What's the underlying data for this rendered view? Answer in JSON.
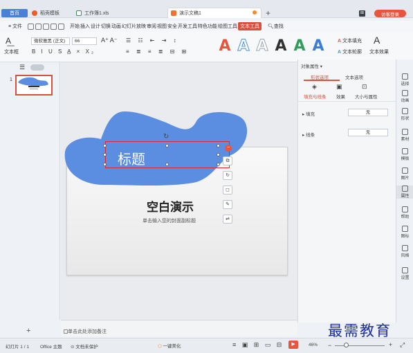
{
  "tabs": {
    "home": "首页",
    "docer": "稻壳模板",
    "xls": "工作簿1.xls",
    "ppt": "演示文稿1",
    "new_tab": "+"
  },
  "login": "访客登录",
  "menu": {
    "file": "≡ 文件",
    "items": [
      "开始",
      "插入",
      "设计",
      "切换",
      "动画",
      "幻灯片放映",
      "审阅",
      "视图",
      "安全",
      "开发工具",
      "特色功能",
      "绘图工具",
      "文本工具"
    ],
    "active_index": 12,
    "search": "查找"
  },
  "ribbon": {
    "textbox": "文本框",
    "font_name": "微软雅黑 (正文)",
    "font_size": "66",
    "text_fill": "文本填充",
    "text_outline": "文本轮廓",
    "text_effect": "文本效果",
    "wordart_colors": [
      "#e8553e",
      "#4a90d9",
      "#9aa4b0",
      "#333333",
      "#2f9e5a",
      "#3d7dd6"
    ]
  },
  "thumbs": {
    "toggle": "☰",
    "slide_number": "1"
  },
  "slide": {
    "placeholder_title": "标题",
    "title": "空白演示",
    "subtitle": "单击输入您的封面副标题",
    "shape_color": "#5b8ee0"
  },
  "notes": {
    "placeholder": "单击此处添加备注",
    "add": "+"
  },
  "rightpanel": {
    "header": "对象属性 ▾",
    "tabs": [
      "形状选项",
      "文本选项"
    ],
    "subtabs": [
      "填充与线条",
      "效果",
      "大小与属性"
    ],
    "fill_label": "填充",
    "fill_value": "无",
    "line_label": "线条",
    "line_value": "无"
  },
  "sidetools": [
    "选择",
    "动画",
    "形状",
    "素材",
    "模板",
    "图片",
    "属性",
    "帮助",
    "图标",
    "风格",
    "设置"
  ],
  "status": {
    "slide": "幻灯片 1 / 1",
    "theme": "Office 主题",
    "protect": "文档未保护",
    "beautify": "一键美化",
    "zoom": "46%"
  },
  "watermark": "最需教育"
}
